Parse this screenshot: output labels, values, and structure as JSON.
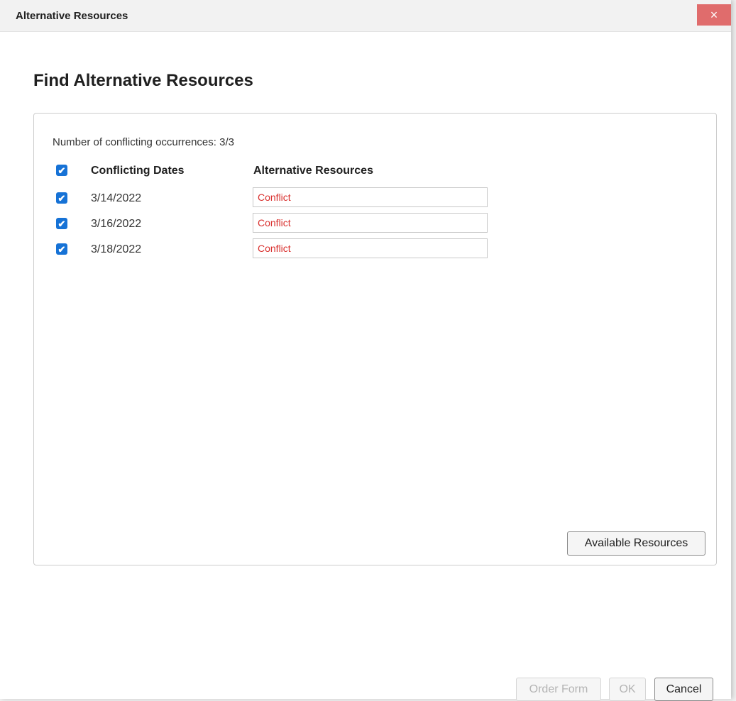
{
  "window": {
    "title": "Alternative Resources",
    "close_glyph": "×"
  },
  "heading": "Find Alternative Resources",
  "summary": {
    "text": "Number of conflicting occurrences: 3/3"
  },
  "table": {
    "select_all_checked": true,
    "headers": {
      "dates": "Conflicting Dates",
      "resources": "Alternative Resources"
    },
    "rows": [
      {
        "checked": true,
        "date": "3/14/2022",
        "resource": "Conflict"
      },
      {
        "checked": true,
        "date": "3/16/2022",
        "resource": "Conflict"
      },
      {
        "checked": true,
        "date": "3/18/2022",
        "resource": "Conflict"
      }
    ]
  },
  "buttons": {
    "available_resources": "Available Resources",
    "order_form": "Order Form",
    "ok": "OK",
    "cancel": "Cancel"
  },
  "icons": {
    "checkmark": "✔"
  },
  "colors": {
    "checkbox_blue": "#1672d6",
    "conflict_red": "#d9302e",
    "close_red": "#e06c6c"
  }
}
